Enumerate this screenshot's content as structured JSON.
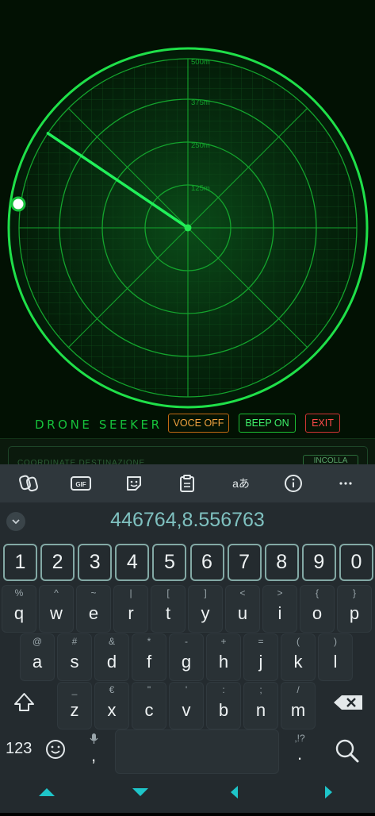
{
  "radar": {
    "range_labels": [
      "500m",
      "375m",
      "250m",
      "125m"
    ],
    "sweep_angle_deg": 146,
    "colors": {
      "grid": "#14a42d",
      "bright": "#1fe049",
      "sweep": "#21f05a",
      "target": "#ffffff"
    }
  },
  "app": {
    "title": "DRONE SEEKER",
    "buttons": {
      "voce": "VOCE OFF",
      "beep": "BEEP ON",
      "exit": "EXIT"
    },
    "destination_label": "COORDINATE DESTINAZIONE",
    "paste_button": "INCOLLA"
  },
  "keyboard": {
    "toolbar": {
      "gif": "GIF",
      "translate": "aあ",
      "icons": [
        "copilot-icon",
        "gif-icon",
        "sticker-icon",
        "clipboard-icon",
        "translate-icon",
        "info-icon",
        "more-icon"
      ]
    },
    "suggestion": "446764,8.556763",
    "number_row": [
      "1",
      "2",
      "3",
      "4",
      "5",
      "6",
      "7",
      "8",
      "9",
      "0"
    ],
    "row1": [
      {
        "main": "q",
        "sec": "%"
      },
      {
        "main": "w",
        "sec": "^"
      },
      {
        "main": "e",
        "sec": "~"
      },
      {
        "main": "r",
        "sec": "|"
      },
      {
        "main": "t",
        "sec": "["
      },
      {
        "main": "y",
        "sec": "]"
      },
      {
        "main": "u",
        "sec": "<"
      },
      {
        "main": "i",
        "sec": ">"
      },
      {
        "main": "o",
        "sec": "{"
      },
      {
        "main": "p",
        "sec": "}"
      }
    ],
    "row2": [
      {
        "main": "a",
        "sec": "@"
      },
      {
        "main": "s",
        "sec": "#"
      },
      {
        "main": "d",
        "sec": "&"
      },
      {
        "main": "f",
        "sec": "*"
      },
      {
        "main": "g",
        "sec": "-"
      },
      {
        "main": "h",
        "sec": "+"
      },
      {
        "main": "j",
        "sec": "="
      },
      {
        "main": "k",
        "sec": "("
      },
      {
        "main": "l",
        "sec": ")"
      }
    ],
    "row3": [
      {
        "main": "z",
        "sec": "_"
      },
      {
        "main": "x",
        "sec": "€"
      },
      {
        "main": "c",
        "sec": "\""
      },
      {
        "main": "v",
        "sec": "'"
      },
      {
        "main": "b",
        "sec": ":"
      },
      {
        "main": "n",
        "sec": ";"
      },
      {
        "main": "m",
        "sec": "/"
      }
    ],
    "bottom": {
      "mode_key": "123",
      "comma": ",",
      "period": ".",
      "period_sec": ",!?"
    }
  }
}
